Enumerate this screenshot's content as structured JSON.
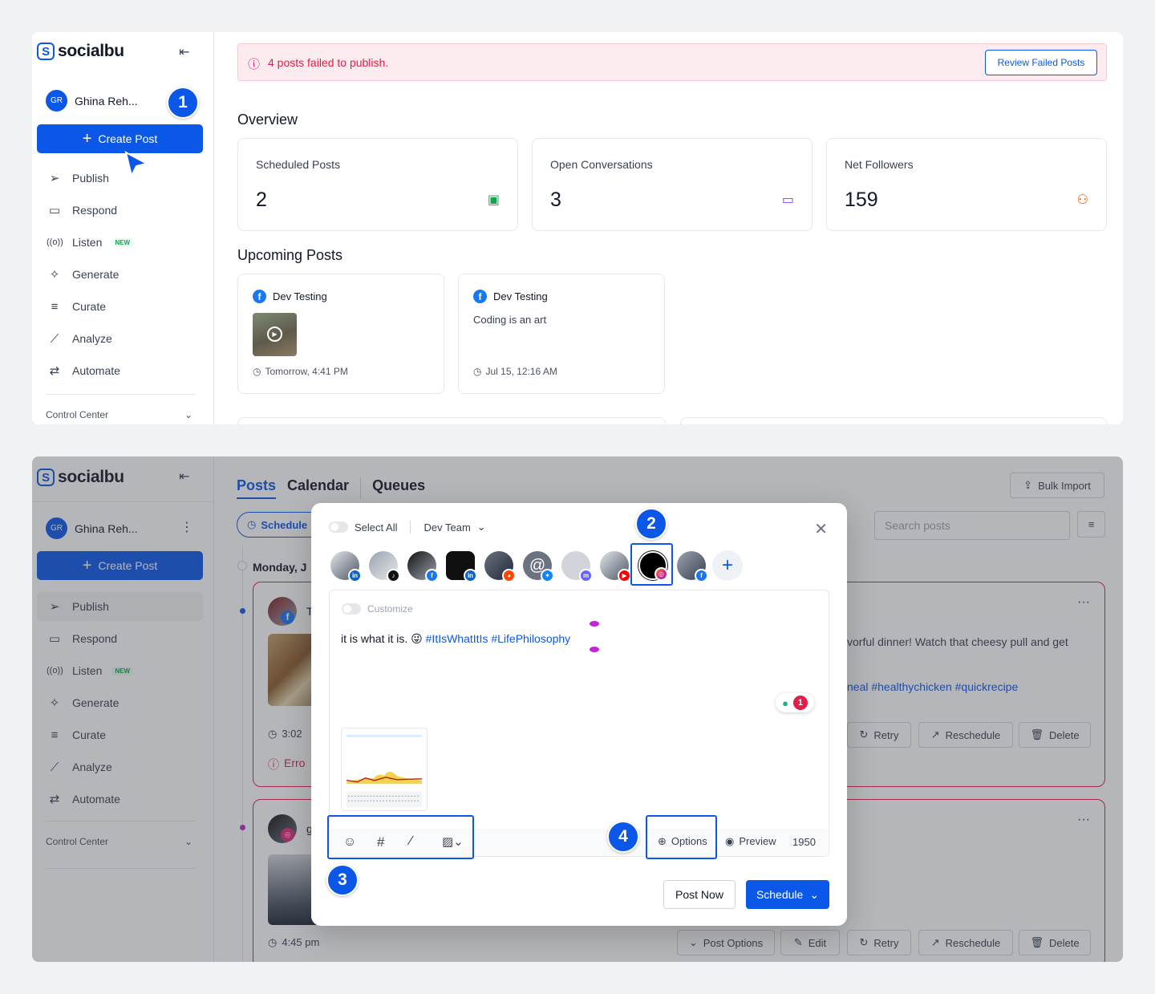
{
  "brand": {
    "name": "socialbu"
  },
  "user": {
    "initials": "GR",
    "name": "Ghina Reh..."
  },
  "sidebar": {
    "create_post": "Create Post",
    "items": [
      {
        "label": "Publish",
        "icon": "send-icon"
      },
      {
        "label": "Respond",
        "icon": "chat-icon"
      },
      {
        "label": "Listen",
        "icon": "broadcast-icon",
        "badge": "NEW"
      },
      {
        "label": "Generate",
        "icon": "sparkle-icon"
      },
      {
        "label": "Curate",
        "icon": "curate-icon"
      },
      {
        "label": "Analyze",
        "icon": "chart-line-icon"
      },
      {
        "label": "Automate",
        "icon": "repeat-icon"
      }
    ],
    "control_center": "Control Center"
  },
  "markers": {
    "m1": "1",
    "m2": "2",
    "m3": "3",
    "m4": "4"
  },
  "dashboard": {
    "alert": {
      "text": "4 posts failed to publish.",
      "button": "Review Failed Posts"
    },
    "overview_title": "Overview",
    "stats": [
      {
        "label": "Scheduled Posts",
        "value": "2",
        "icon": "calendar-icon",
        "color": "#16a34a"
      },
      {
        "label": "Open Conversations",
        "value": "3",
        "icon": "message-icon",
        "color": "#7c3aed"
      },
      {
        "label": "Net Followers",
        "value": "159",
        "icon": "users-icon",
        "color": "#ea580c"
      }
    ],
    "upcoming_title": "Upcoming Posts",
    "upcoming": [
      {
        "account": "Dev Testing",
        "text": "",
        "time": "Tomorrow, 4:41 PM"
      },
      {
        "account": "Dev Testing",
        "text": "Coding is an art",
        "time": "Jul 15, 12:16 AM"
      }
    ]
  },
  "posts_page": {
    "tabs": [
      "Posts",
      "Calendar",
      "Queues"
    ],
    "bulk_import": "Bulk Import",
    "filter_chip": "Schedule",
    "search_placeholder": "Search posts",
    "date_header": "Monday, J",
    "post1": {
      "author_initial": "T",
      "text_line1": "vorful dinner! Watch that cheesy pull and get",
      "text_line2": "neal #healthychicken #quickrecipe",
      "time": "3:02",
      "error": "Erro",
      "actions": [
        "Retry",
        "Reschedule",
        "Delete"
      ]
    },
    "post2": {
      "author_initial": "g",
      "time": "4:45 pm",
      "actions": [
        "Post Options",
        "Edit",
        "Retry",
        "Reschedule",
        "Delete"
      ]
    }
  },
  "composer": {
    "select_all": "Select All",
    "team": "Dev Team",
    "customize": "Customize",
    "text_plain": "it is what it is. ",
    "emoji": "😜",
    "hashtags": "#ItIsWhatItIs #LifePhilosophy",
    "ai_count": "1",
    "options": "Options",
    "preview": "Preview",
    "char_count": "1950",
    "post_now": "Post Now",
    "schedule": "Schedule"
  },
  "colors": {
    "accent": "#0b57e8",
    "error": "#e11d48",
    "alert_bg": "#fdecef"
  }
}
